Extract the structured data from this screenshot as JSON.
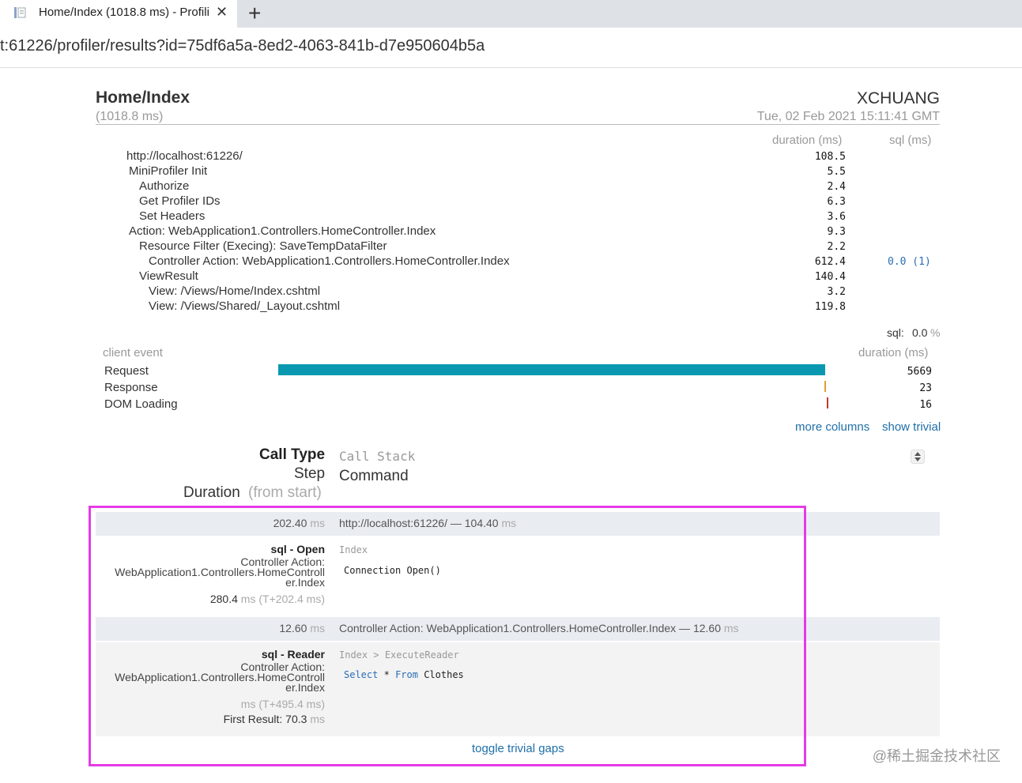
{
  "browser": {
    "tab_title": "Home/Index (1018.8 ms) - Profili",
    "tab_close": "✕",
    "new_tab": "+",
    "address": "t:61226/profiler/results?id=75df6a5a-8ed2-4063-841b-d7e950604b5a"
  },
  "header": {
    "title": "Home/Index",
    "duration": "(1018.8 ms)",
    "machine": "XCHUANG",
    "started": "Tue, 02 Feb 2021 15:11:41 GMT"
  },
  "timings": {
    "col_duration": "duration (ms)",
    "col_sql": "sql (ms)",
    "rows": [
      {
        "name": "http://localhost:61226/",
        "duration": "108.5",
        "sql": ""
      },
      {
        "name": "MiniProfiler Init",
        "duration": "5.5",
        "sql": ""
      },
      {
        "name": "Authorize",
        "duration": "2.4",
        "sql": ""
      },
      {
        "name": "Get Profiler IDs",
        "duration": "6.3",
        "sql": ""
      },
      {
        "name": "Set Headers",
        "duration": "3.6",
        "sql": ""
      },
      {
        "name": "Action: WebApplication1.Controllers.HomeController.Index",
        "duration": "9.3",
        "sql": ""
      },
      {
        "name": "Resource Filter (Execing): SaveTempDataFilter",
        "duration": "2.2",
        "sql": ""
      },
      {
        "name": "Controller Action: WebApplication1.Controllers.HomeController.Index",
        "duration": "612.4",
        "sql": "0.0 (1)"
      },
      {
        "name": "ViewResult",
        "duration": "140.4",
        "sql": ""
      },
      {
        "name": "View: /Views/Home/Index.cshtml",
        "duration": "3.2",
        "sql": ""
      },
      {
        "name": "View: /Views/Shared/_Layout.cshtml",
        "duration": "119.8",
        "sql": ""
      }
    ],
    "sql_label": "sql:",
    "sql_value": "0.0",
    "sql_unit": "%"
  },
  "client": {
    "col_event": "client event",
    "col_duration": "duration (ms)",
    "events": [
      {
        "name": "Request",
        "duration": "5669",
        "color": "#0a98b0"
      },
      {
        "name": "Response",
        "duration": "23",
        "color": "#e0a030"
      },
      {
        "name": "DOM Loading",
        "duration": "16",
        "color": "#c0392b"
      }
    ],
    "more_columns": "more columns",
    "show_trivial": "show trivial"
  },
  "queries": {
    "head_call_type": "Call Type",
    "head_step": "Step",
    "head_duration": "Duration",
    "head_from_start": "(from start)",
    "head_call_stack": "Call Stack",
    "head_command": "Command",
    "gap1_start": "202.40",
    "gap1_unit": "ms",
    "gap1_text": "http://localhost:61226/ — 104.40",
    "gap1_unit2": "ms",
    "q1_type": "sql - Open",
    "q1_step_1": "Controller Action:",
    "q1_step_2": "WebApplication1.Controllers.HomeControll",
    "q1_step_3": "er.Index",
    "q1_dur": "280.4",
    "q1_dur_rest": "ms (T+202.4 ms)",
    "q1_stack": "Index",
    "q1_command": "Connection Open()",
    "gap2_start": "12.60",
    "gap2_unit": "ms",
    "gap2_text": "Controller Action: WebApplication1.Controllers.HomeController.Index — 12.60",
    "gap2_unit2": "ms",
    "q2_type": "sql - Reader",
    "q2_step_1": "Controller Action:",
    "q2_step_2": "WebApplication1.Controllers.HomeControll",
    "q2_step_3": "er.Index",
    "q2_dur_rest": "ms (T+495.4 ms)",
    "q2_first": "First Result: 70.3",
    "q2_first_unit": "ms",
    "q2_stack_1": "Index",
    "q2_stack_sep": ">",
    "q2_stack_2": "ExecuteReader",
    "q2_kw1": "Select",
    "q2_star": "*",
    "q2_kw2": "From",
    "q2_table": "Clothes",
    "toggle": "toggle trivial gaps"
  },
  "watermark": "@稀土掘金技术社区"
}
